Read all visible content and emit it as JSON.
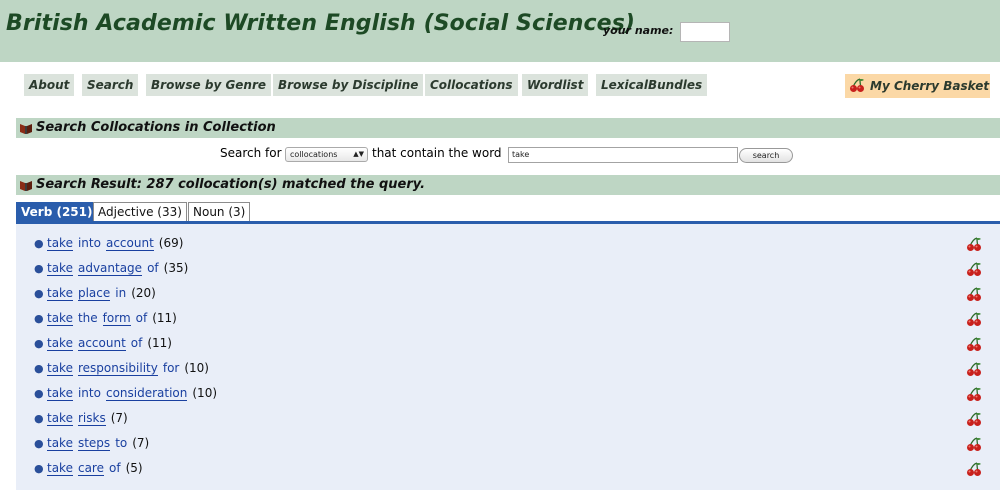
{
  "header": {
    "title": "British Academic Written English (Social Sciences)",
    "name_label": "your name:",
    "name_value": ""
  },
  "nav": {
    "items": [
      "About",
      "Search",
      "Browse by Genre",
      "Browse by Discipline",
      "Collocations",
      "Wordlist",
      "LexicalBundles"
    ],
    "cherry_basket": "My Cherry Basket"
  },
  "search_section": {
    "title": "Search Collocations in Collection",
    "prefix": "Search for",
    "select_value": "collocations",
    "middle": "that contain the word",
    "word_value": "take",
    "button": "search"
  },
  "result_section": {
    "title": "Search Result: 287 collocation(s) matched the query."
  },
  "tabs": [
    "Verb (251)",
    "Adjective (33)",
    "Noun (3)"
  ],
  "results": [
    {
      "words": [
        "take",
        "into",
        "account"
      ],
      "underline": [
        true,
        false,
        true
      ],
      "count": "(69)"
    },
    {
      "words": [
        "take",
        "advantage",
        "of"
      ],
      "underline": [
        true,
        true,
        false
      ],
      "count": "(35)"
    },
    {
      "words": [
        "take",
        "place",
        "in"
      ],
      "underline": [
        true,
        true,
        false
      ],
      "count": "(20)"
    },
    {
      "words": [
        "take",
        "the",
        "form",
        "of"
      ],
      "underline": [
        true,
        false,
        true,
        false
      ],
      "count": "(11)"
    },
    {
      "words": [
        "take",
        "account",
        "of"
      ],
      "underline": [
        true,
        true,
        false
      ],
      "count": "(11)"
    },
    {
      "words": [
        "take",
        "responsibility",
        "for"
      ],
      "underline": [
        true,
        true,
        false
      ],
      "count": "(10)"
    },
    {
      "words": [
        "take",
        "into",
        "consideration"
      ],
      "underline": [
        true,
        false,
        true
      ],
      "count": "(10)"
    },
    {
      "words": [
        "take",
        "risks"
      ],
      "underline": [
        true,
        true
      ],
      "count": "(7)"
    },
    {
      "words": [
        "take",
        "steps",
        "to"
      ],
      "underline": [
        true,
        true,
        false
      ],
      "count": "(7)"
    },
    {
      "words": [
        "take",
        "care",
        "of"
      ],
      "underline": [
        true,
        true,
        false
      ],
      "count": "(5)"
    }
  ],
  "colors": {
    "header_bg": "#bed6c4",
    "title": "#1d4a25",
    "tab_active": "#2a5dac",
    "link": "#1a40a0",
    "results_bg": "#e9eef8",
    "cherry": "#c8201c"
  },
  "icons": {
    "cherry": "cherry-icon",
    "section": "book-icon"
  }
}
